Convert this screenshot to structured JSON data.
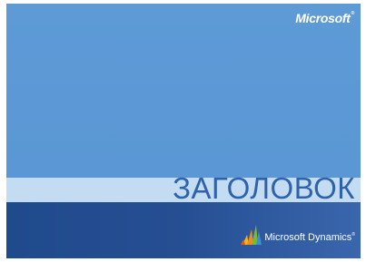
{
  "slide": {
    "brand": "Microsoft",
    "title": "ЗАГОЛОВОК",
    "product": "Microsoft Dynamics",
    "trademark": "®"
  },
  "icons": {
    "product_logo": "microsoft-dynamics-logo-icon"
  },
  "colors": {
    "top_band": "#5a97d4",
    "title_band": "#c4dcf2",
    "title_text": "#2e62aa",
    "bottom_band": "#264f93"
  }
}
